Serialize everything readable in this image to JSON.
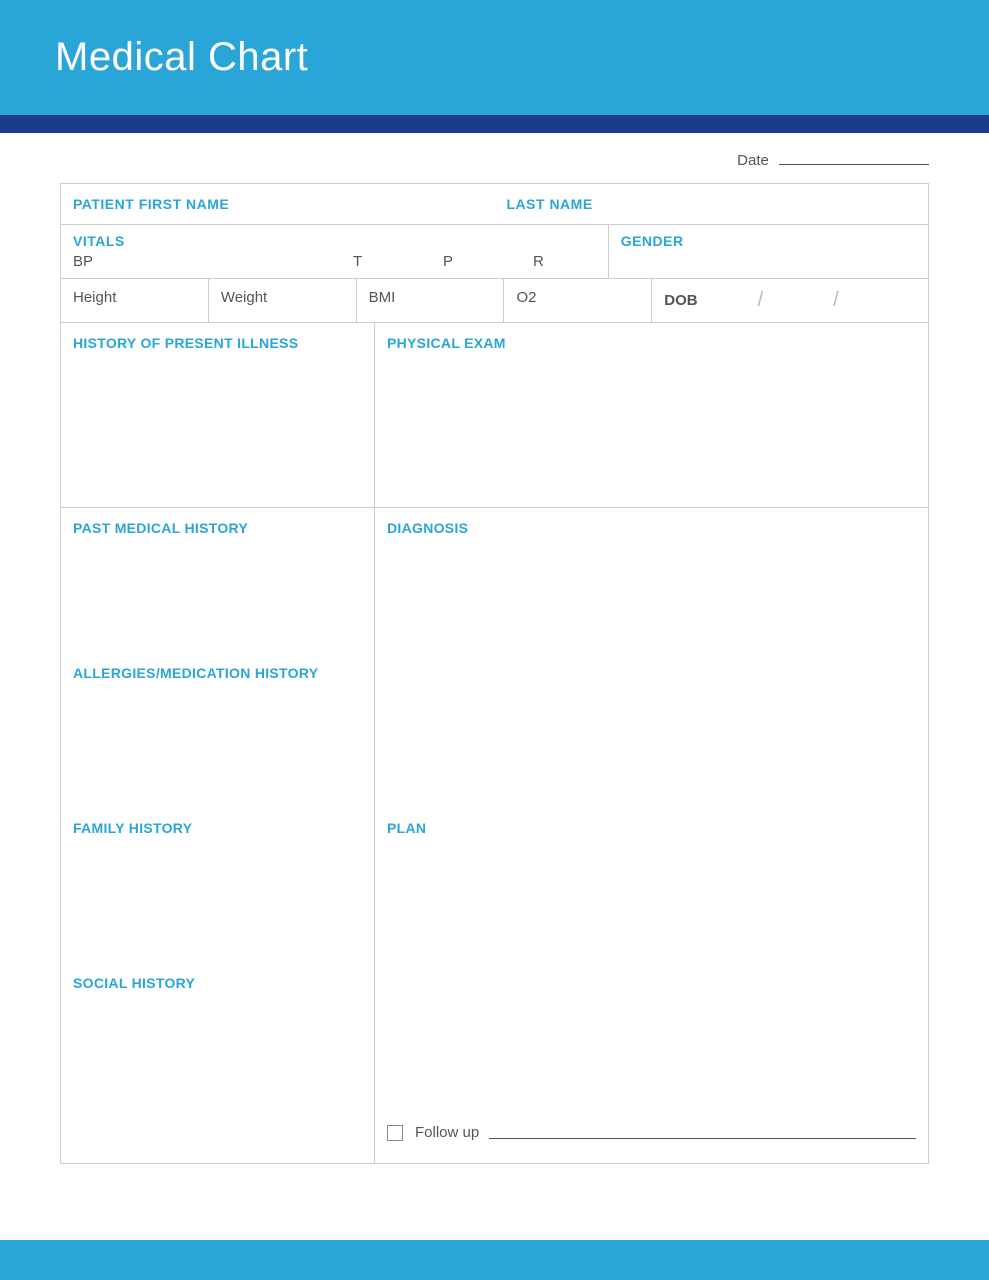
{
  "header": {
    "title": "Medical Chart"
  },
  "date": {
    "label": "Date"
  },
  "patient": {
    "first_label": "PATIENT FIRST NAME",
    "last_label": "LAST NAME"
  },
  "vitals": {
    "label": "VITALS",
    "bp": "BP",
    "t": "T",
    "p": "P",
    "r": "R",
    "gender_label": "GENDER",
    "height": "Height",
    "weight": "Weight",
    "bmi": "BMI",
    "o2": "O2",
    "dob_label": "DOB"
  },
  "sections": {
    "hpi": "HISTORY OF PRESENT ILLNESS",
    "pe": "PHYSICAL EXAM",
    "pmh": "PAST MEDICAL HISTORY",
    "amh": "ALLERGIES/MEDICATION HISTORY",
    "fh": "FAMILY HISTORY",
    "sh": "SOCIAL HISTORY",
    "dx": "DIAGNOSIS",
    "plan": "PLAN",
    "followup": "Follow up"
  }
}
